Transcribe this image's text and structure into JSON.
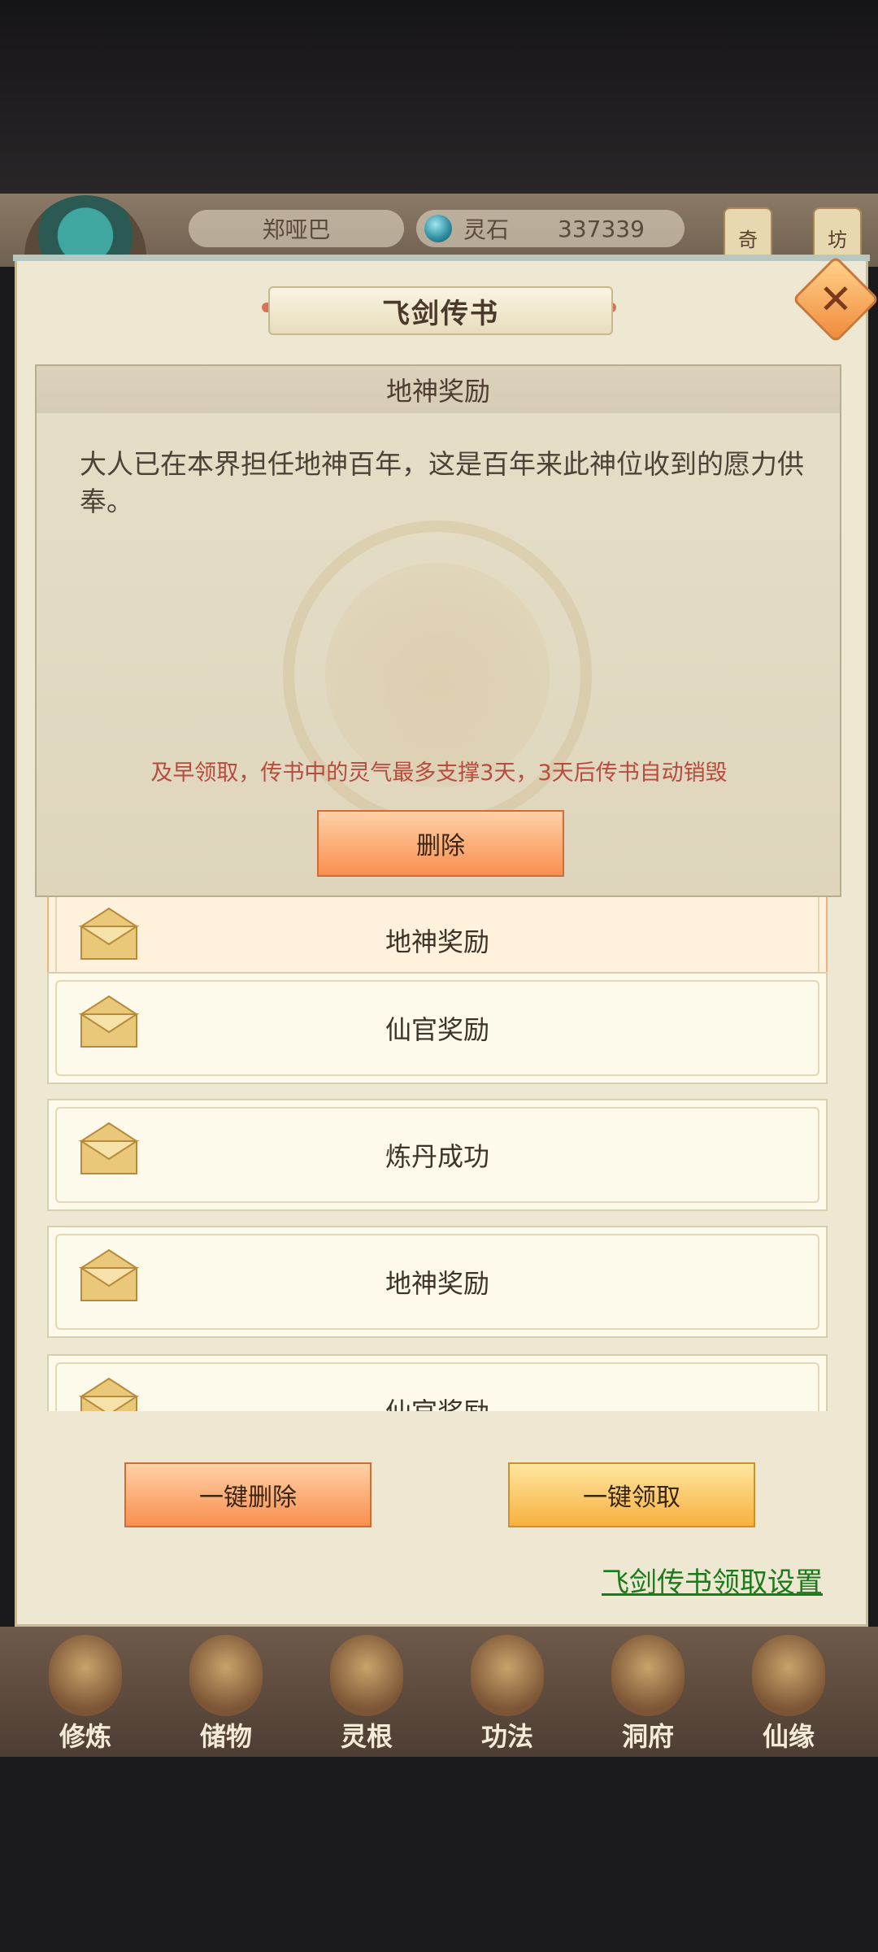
{
  "hud": {
    "player_name": "郑哑巴",
    "currency_label": "灵石",
    "currency_value": "337339",
    "tab_qi": "奇",
    "tab_fang": "坊"
  },
  "dialog": {
    "title": "飞剑传书",
    "detail": {
      "heading": "地神奖励",
      "body": "大人已在本界担任地神百年，这是百年来此神位收到的愿力供奉。",
      "warning": "及早领取，传书中的灵气最多支撑3天，3天后传书自动销毁",
      "delete_label": "删除"
    },
    "mail_list": [
      {
        "label": "地神奖励"
      },
      {
        "label": "仙官奖励"
      },
      {
        "label": "炼丹成功"
      },
      {
        "label": "地神奖励"
      },
      {
        "label": "仙官奖励"
      }
    ],
    "delete_all_label": "一键删除",
    "claim_all_label": "一键领取",
    "settings_link": "飞剑传书领取设置"
  },
  "bottom_nav": [
    {
      "label": "修炼",
      "icon": "cultivation-icon"
    },
    {
      "label": "储物",
      "icon": "storage-bag-icon"
    },
    {
      "label": "灵根",
      "icon": "spirit-root-icon"
    },
    {
      "label": "功法",
      "icon": "technique-book-icon"
    },
    {
      "label": "洞府",
      "icon": "cave-dwelling-icon"
    },
    {
      "label": "仙缘",
      "icon": "fate-icon"
    }
  ],
  "colors": {
    "panel_bg": "#eee8d3",
    "warning_text": "#b94a3e",
    "link_green": "#1b7a1b",
    "button_orange": "#f98f4f",
    "button_yellow": "#f6b13f"
  }
}
